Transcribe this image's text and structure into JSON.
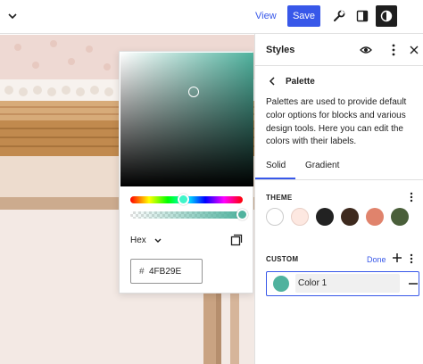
{
  "toolbar": {
    "view_label": "View",
    "save_label": "Save",
    "icons": [
      "chevron-down-icon",
      "wrench-icon",
      "sidebar-toggle-icon",
      "styles-contrast-icon"
    ],
    "accent_color": "#3858e9"
  },
  "picker": {
    "mode_label": "Hex",
    "hex_prefix": "#",
    "hex_value": "4FB29E",
    "current_color": "#4FB29E",
    "alpha_percent": 100
  },
  "sidebar": {
    "title": "Styles",
    "palette_title": "Palette",
    "description": "Palettes are used to provide default color options for blocks and various design tools. Here you can edit the colors with their labels.",
    "tabs": [
      {
        "label": "Solid",
        "active": true
      },
      {
        "label": "Gradient",
        "active": false
      }
    ],
    "theme_label": "THEME",
    "theme_colors": [
      "#ffffff",
      "#fde8e1",
      "#222222",
      "#3e2a1e",
      "#e0836c",
      "#4a5f3a"
    ],
    "custom_label": "CUSTOM",
    "done_label": "Done",
    "custom_colors": [
      {
        "name": "Color 1",
        "color": "#4FB29E"
      }
    ]
  }
}
